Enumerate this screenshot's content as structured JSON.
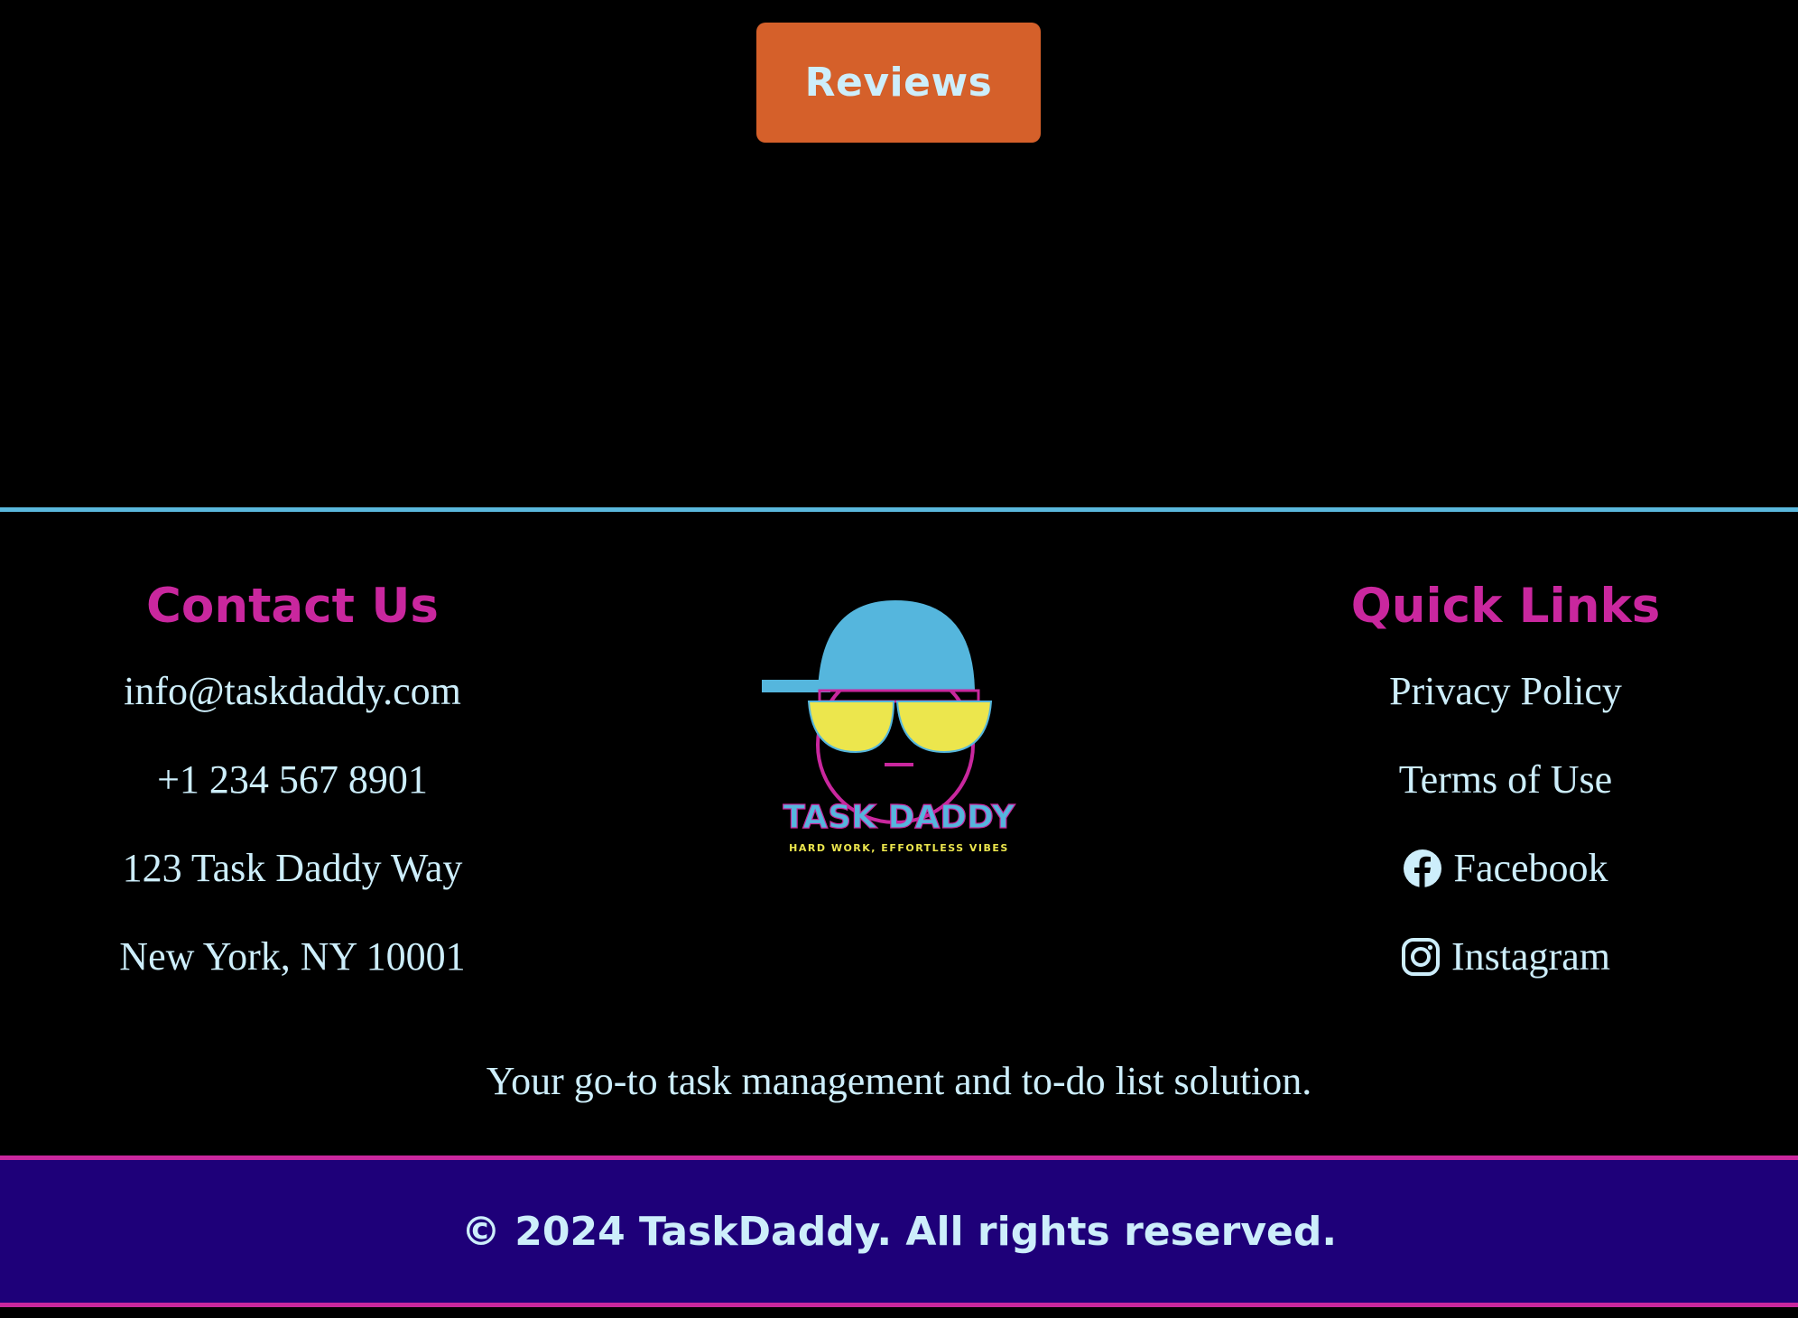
{
  "top": {
    "reviews_label": "Reviews"
  },
  "contact": {
    "heading": "Contact Us",
    "email": "info@taskdaddy.com",
    "phone": "+1 234 567 8901",
    "address_line1": "123 Task Daddy Way",
    "address_line2": "New York, NY 10001"
  },
  "logo": {
    "name": "TASK DADDY",
    "slogan": "HARD WORK, EFFORTLESS VIBES"
  },
  "quick_links": {
    "heading": "Quick Links",
    "items": [
      {
        "label": "Privacy Policy",
        "icon": ""
      },
      {
        "label": "Terms of Use",
        "icon": ""
      },
      {
        "label": "Facebook",
        "icon": "facebook-icon"
      },
      {
        "label": "Instagram",
        "icon": "instagram-icon"
      }
    ]
  },
  "tagline": "Your go-to task management and to-do list solution.",
  "copyright": "© 2024 TaskDaddy. All rights reserved.",
  "colors": {
    "background": "#000000",
    "button": "#d5602a",
    "heading": "#c9279e",
    "text": "#cdeefb",
    "divider": "#5ab8dd",
    "copyright_bg": "#1e0079",
    "logo_cap": "#55b6dd",
    "logo_glasses": "#ece64d"
  }
}
